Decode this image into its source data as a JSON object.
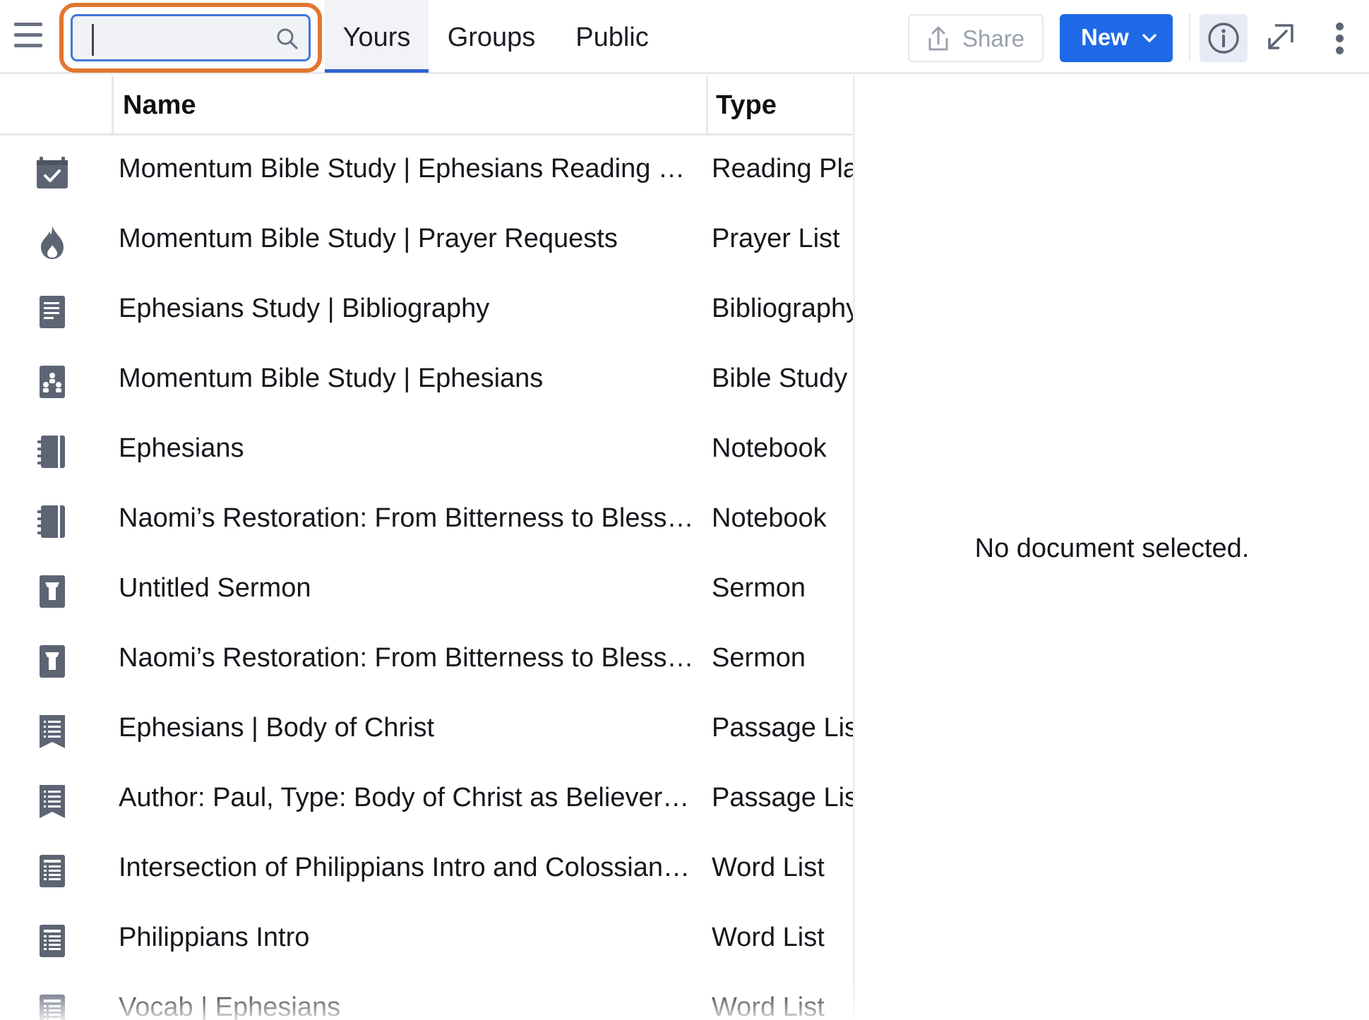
{
  "toolbar": {
    "search": {
      "value": "",
      "placeholder": ""
    },
    "tabs": [
      {
        "label": "Yours",
        "active": true
      },
      {
        "label": "Groups",
        "active": false
      },
      {
        "label": "Public",
        "active": false
      }
    ],
    "share_label": "Share",
    "new_label": "New"
  },
  "list": {
    "columns": {
      "name": "Name",
      "type": "Type"
    },
    "rows": [
      {
        "icon": "calendar-check-icon",
        "name": "Momentum Bible Study | Ephesians Reading Plan",
        "type": "Reading Plan"
      },
      {
        "icon": "flame-icon",
        "name": "Momentum Bible Study | Prayer Requests",
        "type": "Prayer List"
      },
      {
        "icon": "document-lines-icon",
        "name": "Ephesians Study | Bibliography",
        "type": "Bibliography"
      },
      {
        "icon": "group-study-icon",
        "name": "Momentum Bible Study | Ephesians",
        "type": "Bible Study"
      },
      {
        "icon": "notebook-icon",
        "name": "Ephesians",
        "type": "Notebook"
      },
      {
        "icon": "notebook-icon",
        "name": "Naomi’s Restoration: From Bitterness to Blessing",
        "type": "Notebook"
      },
      {
        "icon": "pulpit-icon",
        "name": "Untitled Sermon",
        "type": "Sermon"
      },
      {
        "icon": "pulpit-icon",
        "name": "Naomi’s Restoration: From Bitterness to Blessing",
        "type": "Sermon"
      },
      {
        "icon": "bookmark-list-icon",
        "name": "Ephesians | Body of Christ",
        "type": "Passage List"
      },
      {
        "icon": "bookmark-list-icon",
        "name": "Author: Paul, Type: Body of Christ as Believers, Ecclesiology",
        "type": "Passage List"
      },
      {
        "icon": "word-list-icon",
        "name": "Intersection of Philippians Intro and Colossians Intro",
        "type": "Word List"
      },
      {
        "icon": "word-list-icon",
        "name": "Philippians Intro",
        "type": "Word List"
      },
      {
        "icon": "word-list-icon",
        "name": "Vocab | Ephesians",
        "type": "Word List"
      }
    ]
  },
  "detail": {
    "empty_message": "No document selected."
  },
  "colors": {
    "accent": "#1e6ae6",
    "search_highlight": "#e2762f",
    "icon": "#5d6474"
  }
}
